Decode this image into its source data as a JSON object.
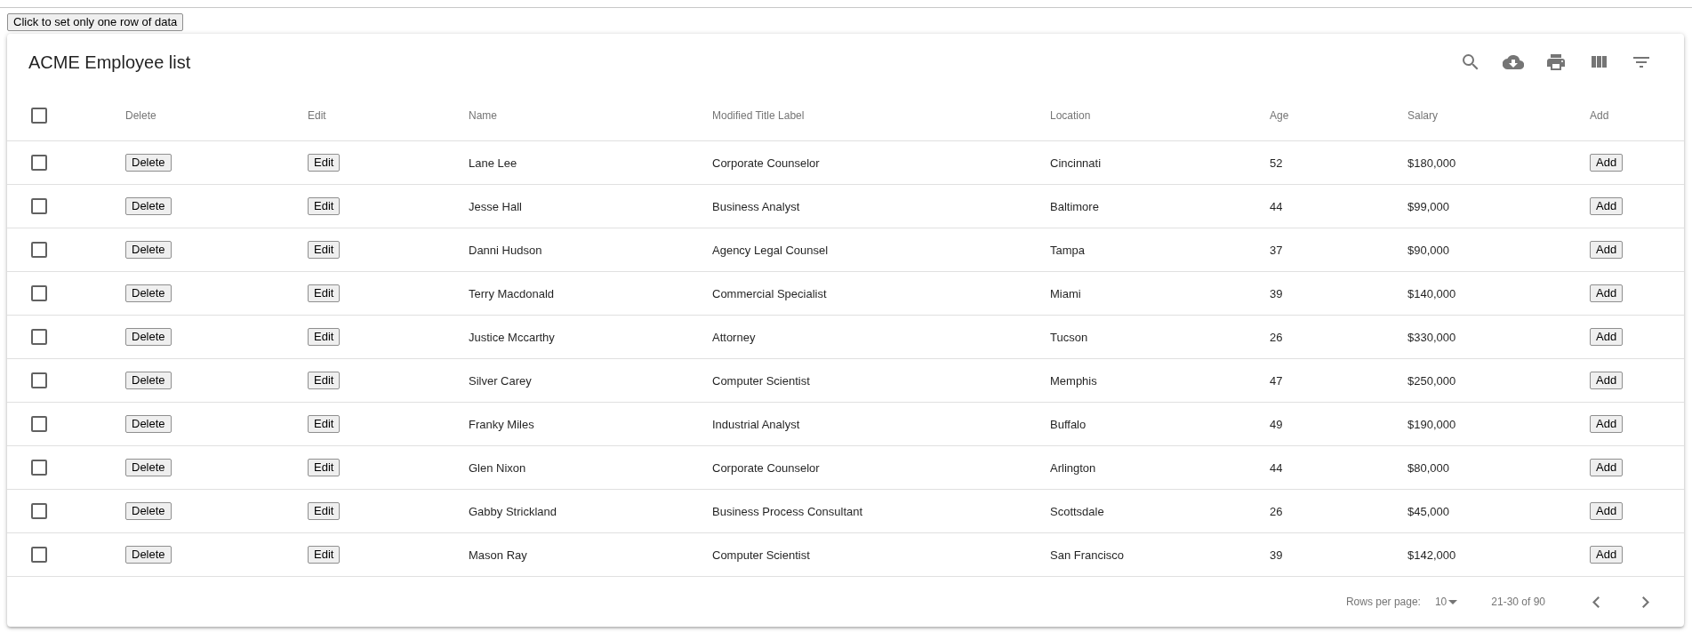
{
  "top_button": "Click to set only one row of data",
  "table": {
    "title": "ACME Employee list",
    "toolbar": [
      {
        "kind": "search"
      },
      {
        "kind": "download"
      },
      {
        "kind": "print"
      },
      {
        "kind": "columns"
      },
      {
        "kind": "filter"
      }
    ],
    "select_all": {
      "checked": false
    },
    "columns": [
      "Delete",
      "Edit",
      "Name",
      "Modified Title Label",
      "Location",
      "Age",
      "Salary",
      "Add"
    ],
    "rows": [
      {
        "checked": false,
        "delete": "Delete",
        "edit": "Edit",
        "name": "Lane Lee",
        "title": "Corporate Counselor",
        "location": "Cincinnati",
        "age": "52",
        "salary": "$180,000",
        "add": "Add"
      },
      {
        "checked": false,
        "delete": "Delete",
        "edit": "Edit",
        "name": "Jesse Hall",
        "title": "Business Analyst",
        "location": "Baltimore",
        "age": "44",
        "salary": "$99,000",
        "add": "Add"
      },
      {
        "checked": false,
        "delete": "Delete",
        "edit": "Edit",
        "name": "Danni Hudson",
        "title": "Agency Legal Counsel",
        "location": "Tampa",
        "age": "37",
        "salary": "$90,000",
        "add": "Add"
      },
      {
        "checked": false,
        "delete": "Delete",
        "edit": "Edit",
        "name": "Terry Macdonald",
        "title": "Commercial Specialist",
        "location": "Miami",
        "age": "39",
        "salary": "$140,000",
        "add": "Add"
      },
      {
        "checked": false,
        "delete": "Delete",
        "edit": "Edit",
        "name": "Justice Mccarthy",
        "title": "Attorney",
        "location": "Tucson",
        "age": "26",
        "salary": "$330,000",
        "add": "Add"
      },
      {
        "checked": false,
        "delete": "Delete",
        "edit": "Edit",
        "name": "Silver Carey",
        "title": "Computer Scientist",
        "location": "Memphis",
        "age": "47",
        "salary": "$250,000",
        "add": "Add"
      },
      {
        "checked": false,
        "delete": "Delete",
        "edit": "Edit",
        "name": "Franky Miles",
        "title": "Industrial Analyst",
        "location": "Buffalo",
        "age": "49",
        "salary": "$190,000",
        "add": "Add"
      },
      {
        "checked": false,
        "delete": "Delete",
        "edit": "Edit",
        "name": "Glen Nixon",
        "title": "Corporate Counselor",
        "location": "Arlington",
        "age": "44",
        "salary": "$80,000",
        "add": "Add"
      },
      {
        "checked": false,
        "delete": "Delete",
        "edit": "Edit",
        "name": "Gabby Strickland",
        "title": "Business Process Consultant",
        "location": "Scottsdale",
        "age": "26",
        "salary": "$45,000",
        "add": "Add"
      },
      {
        "checked": false,
        "delete": "Delete",
        "edit": "Edit",
        "name": "Mason Ray",
        "title": "Computer Scientist",
        "location": "San Francisco",
        "age": "39",
        "salary": "$142,000",
        "add": "Add"
      }
    ],
    "footer": {
      "rows_per_page_label": "Rows per page:",
      "rows_per_page": "10",
      "range": "21-30 of 90"
    }
  }
}
